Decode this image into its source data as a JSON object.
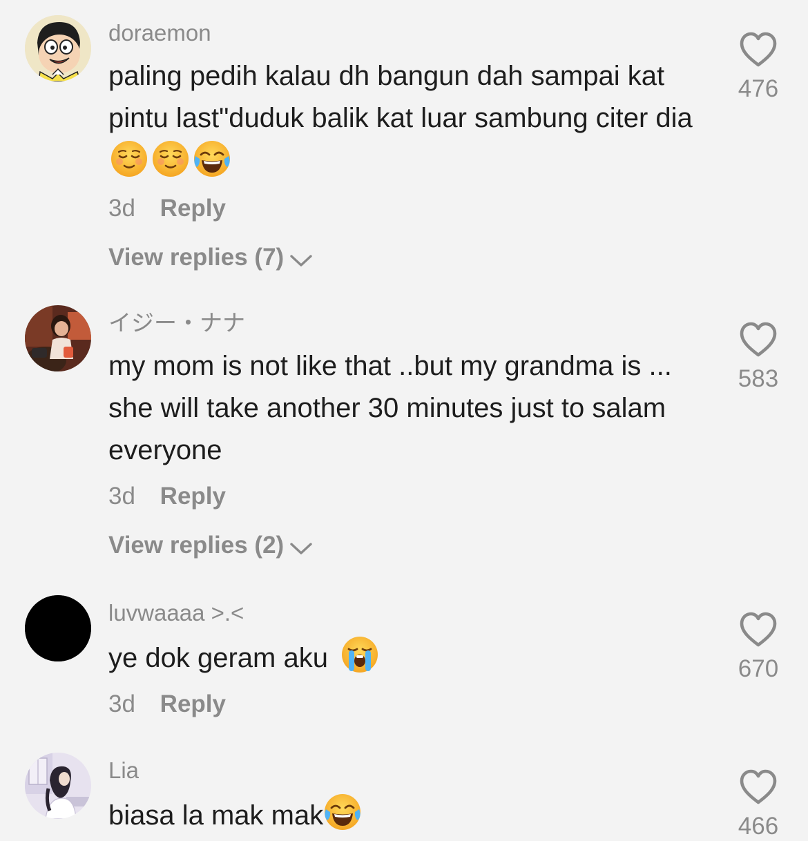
{
  "comments": [
    {
      "username": "doraemon",
      "text": "paling pedih kalau dh bangun dah sampai kat pintu last\"duduk balik kat luar sambung citer dia",
      "emojis": [
        "relieved-face",
        "relieved-face",
        "tears-of-joy-face"
      ],
      "time": "3d",
      "reply_label": "Reply",
      "view_replies": "View replies (7)",
      "likes": "476",
      "avatar": "doraemon-character-avatar"
    },
    {
      "username": "イジー・ナナ",
      "text": "my mom is not like that ..but my grandma is ... she will take another 30 minutes just to salam everyone",
      "emojis": [],
      "time": "3d",
      "reply_label": "Reply",
      "view_replies": "View replies (2)",
      "likes": "583",
      "avatar": "child-photo-avatar"
    },
    {
      "username": "luvwaaaa >.<",
      "text": "ye dok geram aku",
      "emojis": [
        "loudly-crying-face"
      ],
      "time": "3d",
      "reply_label": "Reply",
      "likes": "670",
      "avatar": "black-circle-avatar"
    },
    {
      "username": "Lia",
      "text": "biasa la mak mak",
      "emojis": [
        "tears-of-joy-face"
      ],
      "likes": "466",
      "avatar": "illustrated-girl-avatar"
    }
  ],
  "icons": {
    "like": "heart-outline-icon",
    "expand": "chevron-down-icon"
  },
  "colors": {
    "background": "#f3f3f3",
    "secondary_text": "#8a8a8a",
    "primary_text": "#1d1d1d"
  }
}
